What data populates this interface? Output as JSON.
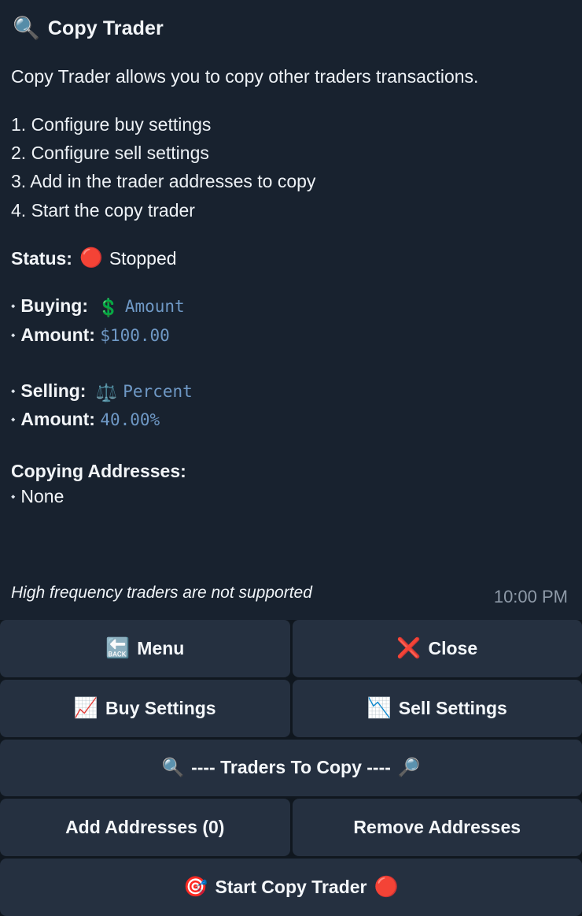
{
  "header": {
    "icon": "🔍",
    "icon_name": "magnifying-glass-icon",
    "title": "Copy Trader"
  },
  "intro": "Copy Trader allows you to copy other traders transactions.",
  "steps": [
    "1. Configure buy settings",
    "2. Configure sell settings",
    "3. Add in the trader addresses to copy",
    "4. Start the copy trader"
  ],
  "status": {
    "label": "Status:",
    "indicator": "🔴",
    "value": "Stopped"
  },
  "buy": {
    "bullet": "⬩",
    "mode_key": "Buying: ",
    "mode_icon": "💲",
    "mode_value": "Amount",
    "amount_key": "Amount: ",
    "amount_value": "$100.00"
  },
  "sell": {
    "bullet": "⬩",
    "mode_key": "Selling: ",
    "mode_icon": "⚖️",
    "mode_value": "Percent",
    "amount_key": "Amount: ",
    "amount_value": "40.00%"
  },
  "addresses": {
    "heading": "Copying Addresses:",
    "bullet": "⬩",
    "value": "None"
  },
  "footnote": "High frequency traders are not supported",
  "timestamp": "10:00 PM",
  "buttons": {
    "menu": {
      "icon": "🔙",
      "label": "Menu"
    },
    "close": {
      "icon": "❌",
      "label": "Close"
    },
    "buy_settings": {
      "icon": "📈",
      "label": "Buy Settings"
    },
    "sell_settings": {
      "icon": "📉",
      "label": "Sell Settings"
    },
    "traders_header": {
      "icon_left": "🔍",
      "label": "---- Traders To Copy ----",
      "icon_right": "🔎"
    },
    "add_addresses": {
      "label": "Add Addresses (0)"
    },
    "remove_addresses": {
      "label": "Remove Addresses"
    },
    "start": {
      "icon_left": "🎯",
      "label": "Start Copy Trader",
      "icon_right": "🔴"
    }
  },
  "colors": {
    "background": "#18222f",
    "button": "#253040",
    "gap": "#10171f",
    "value_text": "#6f99c6",
    "timestamp_text": "#8e9aa8",
    "stopped_indicator": "#e02020"
  }
}
